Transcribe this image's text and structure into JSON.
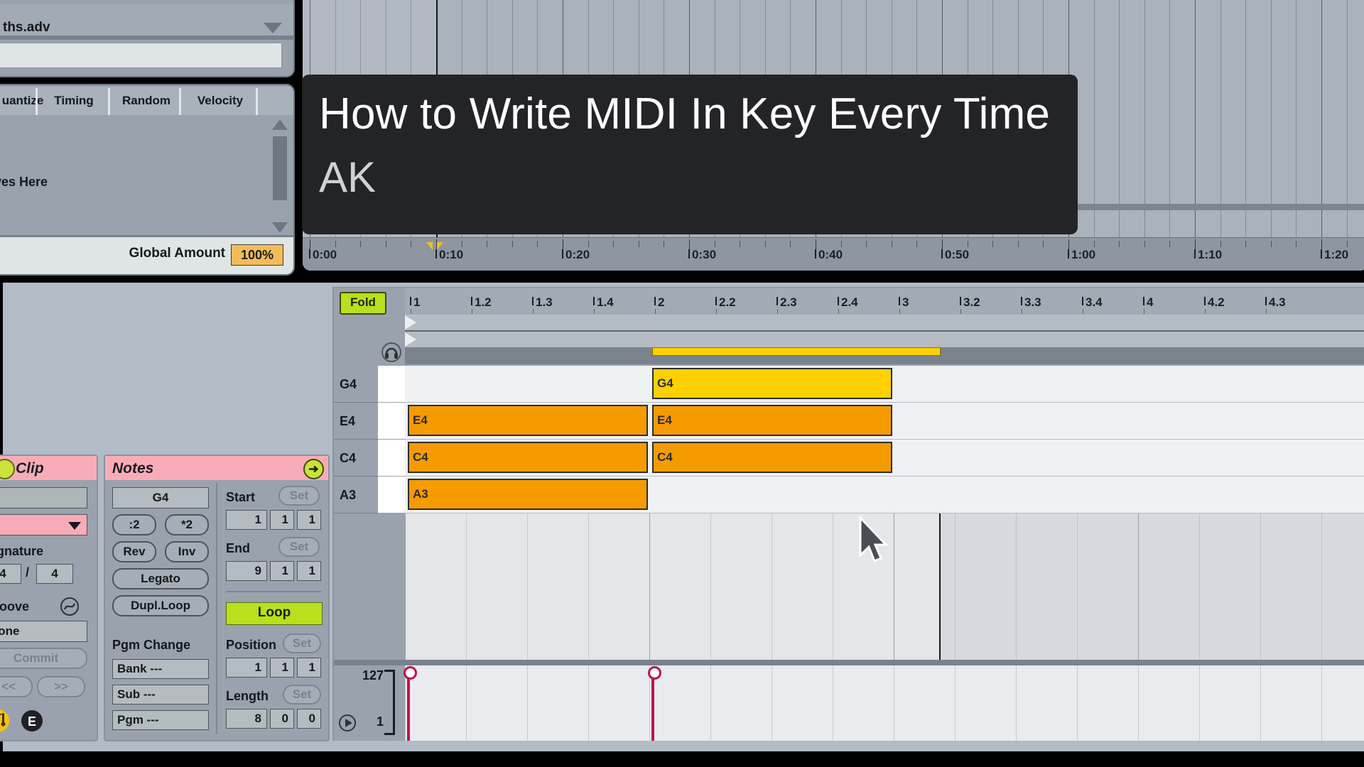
{
  "browser": {
    "preset_name": "ths.adv",
    "caret_icon": "chevron-down-icon",
    "search_value": ""
  },
  "groove_pool": {
    "columns": [
      "uantize",
      "Timing",
      "Random",
      "Velocity"
    ],
    "empty_text": "ooves Here",
    "global_amount_label": "Global Amount",
    "global_amount_value": "100%",
    "scroll_up_icon": "scroll-up-icon",
    "scroll_down_icon": "scroll-down-icon"
  },
  "arrangement": {
    "time_marks": [
      "0:00",
      "0:10",
      "0:20",
      "0:30",
      "0:40",
      "0:50",
      "1:00",
      "1:10",
      "1:20"
    ],
    "loop_start_mark": "0:10",
    "playhead_time": "0:10"
  },
  "title_overlay": {
    "title": "How to Write MIDI In Key Every Time",
    "subtitle": "AK",
    "background_color": "#232427"
  },
  "midi_editor": {
    "fold_label": "Fold",
    "preview_icon": "headphones-icon",
    "bar_marks": [
      "1",
      "1.2",
      "1.3",
      "1.4",
      "2",
      "2.2",
      "2.3",
      "2.4",
      "3",
      "3.2",
      "3.3",
      "3.4",
      "4",
      "4.2",
      "4.3"
    ],
    "key_rows": [
      "G4",
      "E4",
      "C4",
      "A3"
    ],
    "notes": [
      {
        "pitch": "E4",
        "row": 1,
        "start_bar": 1.0,
        "end_bar": 2.0,
        "selected": false
      },
      {
        "pitch": "C4",
        "row": 2,
        "start_bar": 1.0,
        "end_bar": 2.0,
        "selected": false
      },
      {
        "pitch": "A3",
        "row": 3,
        "start_bar": 1.0,
        "end_bar": 2.0,
        "selected": false
      },
      {
        "pitch": "G4",
        "row": 0,
        "start_bar": 2.0,
        "end_bar": 3.0,
        "selected": true
      },
      {
        "pitch": "E4",
        "row": 1,
        "start_bar": 2.0,
        "end_bar": 3.0,
        "selected": false
      },
      {
        "pitch": "C4",
        "row": 2,
        "start_bar": 2.0,
        "end_bar": 3.0,
        "selected": false
      }
    ],
    "velocity": {
      "max_label": "127",
      "min_label": "1",
      "play_icon": "play-circle-icon",
      "stems": [
        {
          "bar": 1.0,
          "value": 127
        },
        {
          "bar": 2.0,
          "value": 127
        }
      ]
    }
  },
  "clip_panel": {
    "title": "Clip",
    "info_icon": "info-circle-icon",
    "name_value": "",
    "color_swatch_caret": "chevron-down-icon",
    "signature_label": "Signature",
    "signature_numerator": "4",
    "signature_separator": "/",
    "signature_denominator": "4",
    "groove_label": "Groove",
    "groove_icon": "groove-icon",
    "groove_value": "None",
    "commit_label": "Commit",
    "prev_label": "<<",
    "next_label": ">>",
    "note_icon": "music-note-icon",
    "envelope_icon": "envelope-e-icon"
  },
  "notes_panel": {
    "title": "Notes",
    "arrow_icon": "arrow-right-circle-icon",
    "pitch_value": "G4",
    "halve_label": ":2",
    "double_label": "*2",
    "reverse_label": "Rev",
    "invert_label": "Inv",
    "legato_label": "Legato",
    "dupl_loop_label": "Dupl.Loop",
    "pgm_change_label": "Pgm Change",
    "bank_label": "Bank ---",
    "sub_label": "Sub ---",
    "pgm_label": "Pgm ---",
    "start_label": "Start",
    "start_set_label": "Set",
    "start_bars": "1",
    "start_beats": "1",
    "start_sixteenths": "1",
    "end_label": "End",
    "end_set_label": "Set",
    "end_bars": "9",
    "end_beats": "1",
    "end_sixteenths": "1",
    "loop_label": "Loop",
    "position_label": "Position",
    "position_set_label": "Set",
    "position_bars": "1",
    "position_beats": "1",
    "position_sixteenths": "1",
    "length_label": "Length",
    "length_set_label": "Set",
    "length_bars": "8",
    "length_beats": "0",
    "length_sixteenths": "0"
  },
  "cursor": {
    "icon": "mouse-pointer-icon"
  }
}
